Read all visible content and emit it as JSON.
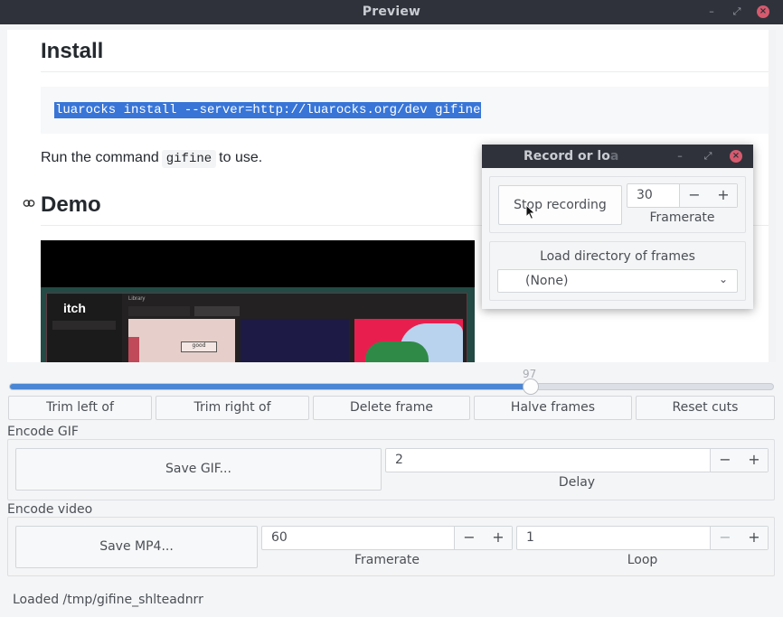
{
  "window": {
    "title": "Preview",
    "controls": {
      "minimize": "–",
      "maximize": "⤢",
      "close": "×"
    }
  },
  "document": {
    "install_heading": "Install",
    "install_command": "luarocks install --server=http://luarocks.org/dev gifine",
    "run_text_before": "Run the command",
    "run_code": "gifine",
    "run_text_after": "to use.",
    "demo_heading": "Demo",
    "anchor_icon": "link-icon",
    "demo_image": {
      "logo_text": "itch",
      "tile_text": "good",
      "library_label": "Library"
    }
  },
  "timeline": {
    "current_frame": "97",
    "position_fraction": 0.683
  },
  "frame_actions": [
    {
      "label": "Trim left of"
    },
    {
      "label": "Trim right of"
    },
    {
      "label": "Delete frame"
    },
    {
      "label": "Halve frames"
    },
    {
      "label": "Reset cuts"
    }
  ],
  "encode_gif": {
    "group_label": "Encode GIF",
    "save_label": "Save GIF...",
    "delay_value": "2",
    "delay_label": "Delay",
    "minus": "−",
    "plus": "+"
  },
  "encode_video": {
    "group_label": "Encode video",
    "save_label": "Save MP4...",
    "framerate_value": "60",
    "framerate_label": "Framerate",
    "loop_value": "1",
    "loop_label": "Loop",
    "minus": "−",
    "plus": "+"
  },
  "status": "Loaded /tmp/gifine_shlteadnrr",
  "record_dialog": {
    "title_visible": "Record or lo",
    "title_faded": "a",
    "stop_label": "Stop recording",
    "framerate_value": "30",
    "framerate_label": "Framerate",
    "load_label": "Load directory of frames",
    "load_selected": "(None)",
    "chevron": "⌄",
    "minus": "−",
    "plus": "+"
  },
  "colors": {
    "titlebar": "#2f323a",
    "accent": "#4a86d4",
    "selection": "#3875d7",
    "close": "#d65a6e"
  }
}
